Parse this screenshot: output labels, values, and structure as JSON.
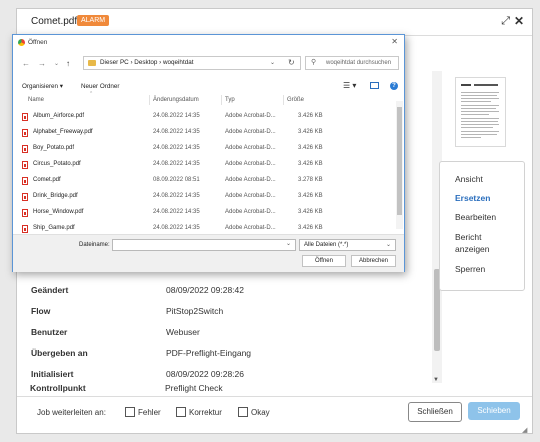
{
  "modal": {
    "title": "Comet.pdf",
    "badge": "ALARM",
    "expand_icon": "expand-icon",
    "close_icon": "close-icon",
    "actions": [
      {
        "label": "Ansicht",
        "active": false
      },
      {
        "label": "Ersetzen",
        "active": true
      },
      {
        "label": "Bearbeiten",
        "active": false
      },
      {
        "label": "Bericht anzeigen",
        "active": false
      },
      {
        "label": "Sperren",
        "active": false
      }
    ],
    "properties": [
      {
        "label": "Geändert",
        "value": "08/09/2022 09:28:42"
      },
      {
        "label": "Flow",
        "value": "PitStop2Switch"
      },
      {
        "label": "Benutzer",
        "value": "Webuser"
      },
      {
        "label": "Übergeben an",
        "value": "PDF-Preflight-Eingang"
      },
      {
        "label": "Initialisiert",
        "value": "08/09/2022 09:28:26"
      },
      {
        "label": "Kontrollpunkt",
        "value": "Preflight Check"
      }
    ],
    "footer": {
      "route_label": "Job weiterleiten an:",
      "checkboxes": [
        "Fehler",
        "Korrektur",
        "Okay"
      ],
      "close_button": "Schließen",
      "send_button": "Schieben"
    }
  },
  "dialog": {
    "title": "Öffnen",
    "close_glyph": "✕",
    "nav": {
      "back": "←",
      "forward": "→",
      "recent": "⌄",
      "up": "↑"
    },
    "breadcrumb": "Dieser PC  ›  Desktop  ›  woqeihtdat",
    "search_placeholder": "woqeihtdat durchsuchen",
    "toolbar": {
      "organize": "Organisieren ▾",
      "new_folder": "Neuer Ordner"
    },
    "columns": [
      "Name",
      "Änderungsdatum",
      "Typ",
      "Größe"
    ],
    "files": [
      {
        "name": "Album_Airforce.pdf",
        "date": "24.08.2022 14:35",
        "type": "Adobe Acrobat-D...",
        "size": "3.426 KB"
      },
      {
        "name": "Alphabet_Freeway.pdf",
        "date": "24.08.2022 14:35",
        "type": "Adobe Acrobat-D...",
        "size": "3.426 KB"
      },
      {
        "name": "Boy_Potato.pdf",
        "date": "24.08.2022 14:35",
        "type": "Adobe Acrobat-D...",
        "size": "3.426 KB"
      },
      {
        "name": "Circus_Potato.pdf",
        "date": "24.08.2022 14:35",
        "type": "Adobe Acrobat-D...",
        "size": "3.426 KB"
      },
      {
        "name": "Comet.pdf",
        "date": "08.09.2022 08:51",
        "type": "Adobe Acrobat-D...",
        "size": "3.278 KB"
      },
      {
        "name": "Drink_Bridge.pdf",
        "date": "24.08.2022 14:35",
        "type": "Adobe Acrobat-D...",
        "size": "3.426 KB"
      },
      {
        "name": "Horse_Window.pdf",
        "date": "24.08.2022 14:35",
        "type": "Adobe Acrobat-D...",
        "size": "3.426 KB"
      },
      {
        "name": "Ship_Game.pdf",
        "date": "24.08.2022 14:35",
        "type": "Adobe Acrobat-D...",
        "size": "3.426 KB"
      }
    ],
    "filename_label": "Dateiname:",
    "filename_value": "",
    "filter": "Alle Dateien (*.*)",
    "open_button": "Öffnen",
    "cancel_button": "Abbrechen"
  },
  "colors": {
    "accent": "#2a6ebd",
    "badge": "#f0893a",
    "send_button": "#8ec3ea"
  }
}
